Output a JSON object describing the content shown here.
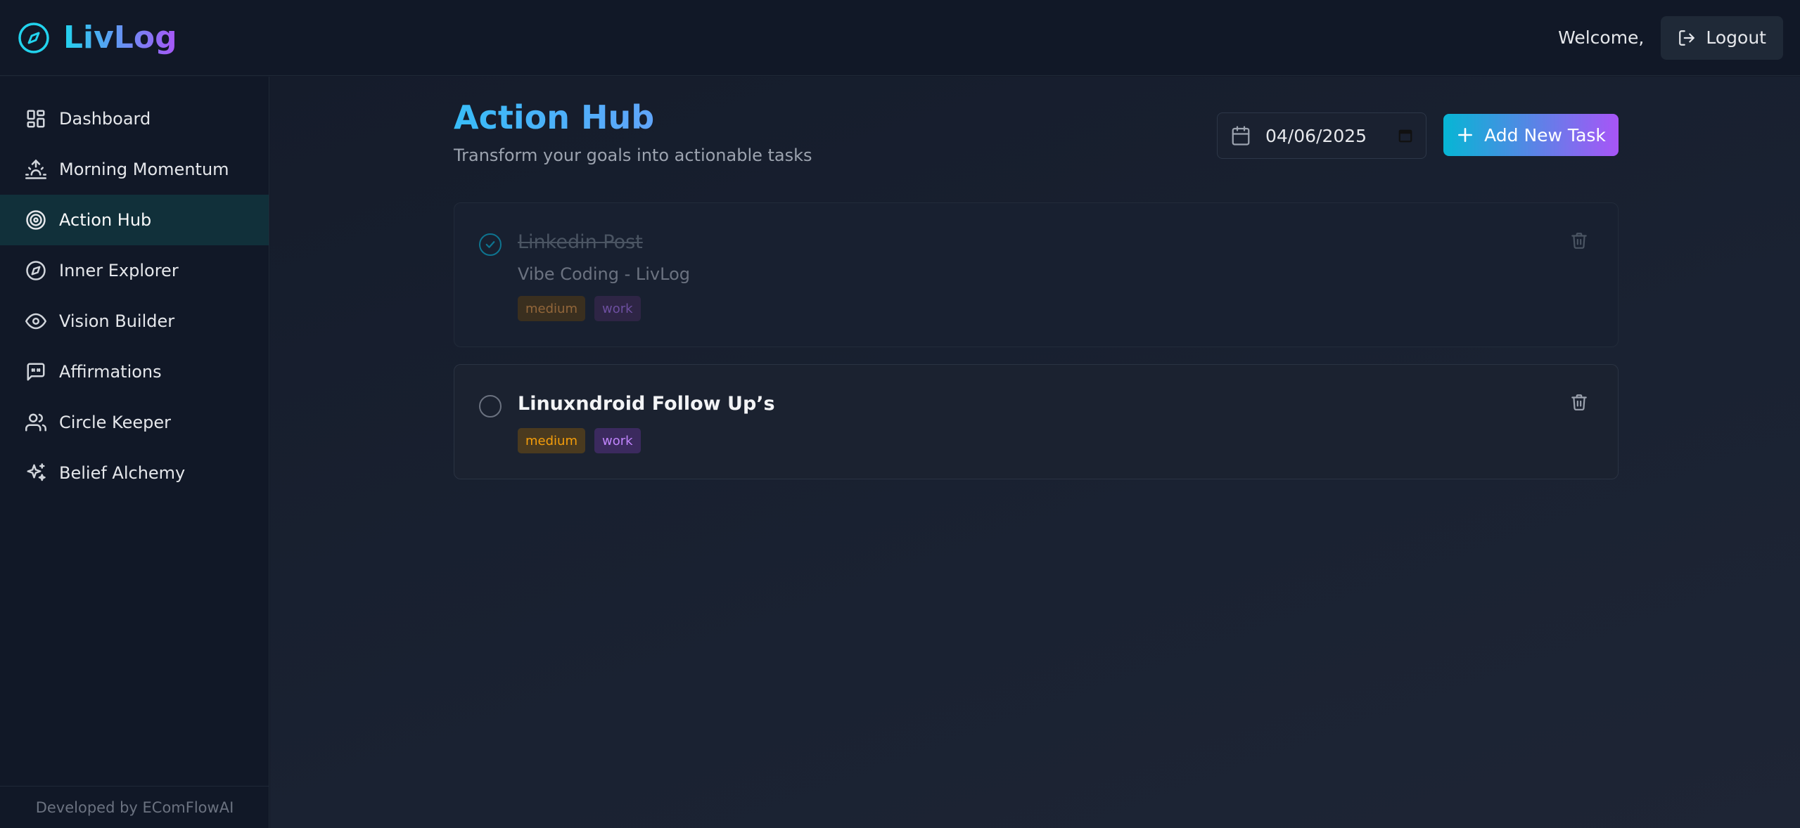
{
  "app": {
    "name": "LivLog",
    "welcome_text": "Welcome,",
    "logout_label": "Logout",
    "footer_text": "Developed by EComFlowAI",
    "accent_gradient": [
      "#06b6d4",
      "#a855f7"
    ]
  },
  "sidebar": {
    "items": [
      {
        "label": "Dashboard",
        "icon": "dashboard-icon",
        "active": false
      },
      {
        "label": "Morning Momentum",
        "icon": "sunrise-icon",
        "active": false
      },
      {
        "label": "Action Hub",
        "icon": "target-icon",
        "active": true
      },
      {
        "label": "Inner Explorer",
        "icon": "compass-icon",
        "active": false
      },
      {
        "label": "Vision Builder",
        "icon": "eye-icon",
        "active": false
      },
      {
        "label": "Affirmations",
        "icon": "message-quote-icon",
        "active": false
      },
      {
        "label": "Circle Keeper",
        "icon": "users-icon",
        "active": false
      },
      {
        "label": "Belief Alchemy",
        "icon": "sparkles-icon",
        "active": false
      }
    ]
  },
  "main": {
    "title": "Action Hub",
    "subtitle": "Transform your goals into actionable tasks",
    "date_value": "04/06/2025",
    "add_task_label": "Add New Task"
  },
  "tasks": [
    {
      "title": "Linkedin Post",
      "description": "Vibe Coding - LivLog",
      "completed": true,
      "tags": [
        "medium",
        "work"
      ]
    },
    {
      "title": "Linuxndroid Follow Up’s",
      "description": "",
      "completed": false,
      "tags": [
        "medium",
        "work"
      ]
    }
  ]
}
